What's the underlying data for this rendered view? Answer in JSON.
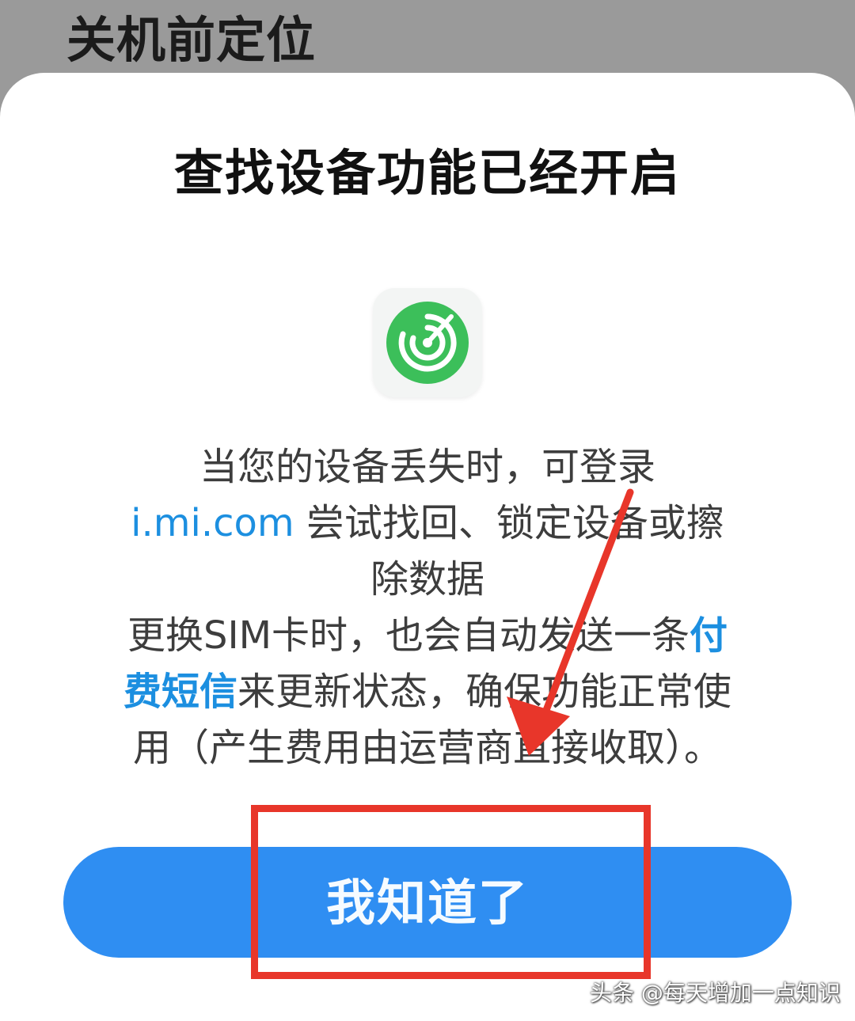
{
  "background": {
    "title": "关机前定位"
  },
  "dialog": {
    "title": "查找设备功能已经开启",
    "app_icon": "find-device-radar-icon",
    "description": {
      "line1": "当您的设备丢失时，可登录",
      "link": "i.mi.com",
      "line2_rest": " 尝试找回、锁定设备或擦",
      "line3": "除数据",
      "line4_a": "更换SIM卡时，也会自动发送一条",
      "line4_hl": "付",
      "line5_hl": "费短信",
      "line5_rest": "来更新状态，确保功能正常使",
      "line6": "用（产生费用由运营商直接收取）。"
    },
    "confirm_label": "我知道了"
  },
  "annotation": {
    "color": "#e8362a"
  },
  "watermark": {
    "text": "头条 @每天增加一点知识"
  },
  "colors": {
    "accent": "#2f8ef2",
    "link": "#1c8fe0",
    "icon_green": "#3cbf5a"
  }
}
